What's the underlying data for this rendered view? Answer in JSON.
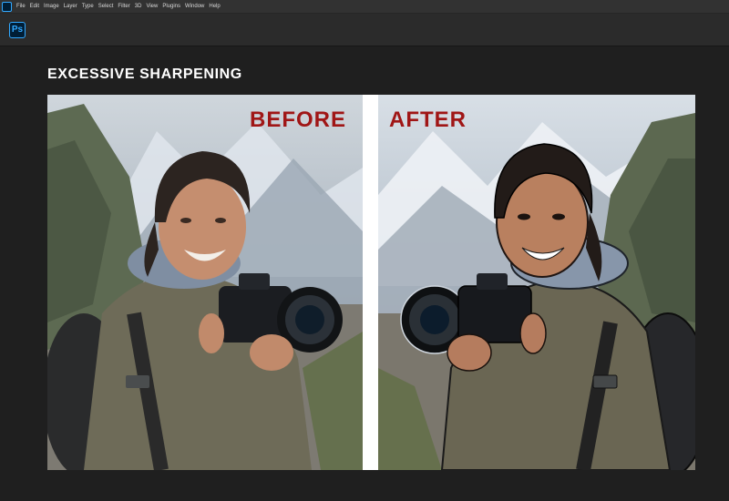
{
  "menubar": {
    "items": [
      "File",
      "Edit",
      "Image",
      "Layer",
      "Type",
      "Select",
      "Filter",
      "3D",
      "View",
      "Plugins",
      "Window",
      "Help"
    ]
  },
  "app": {
    "logo_text": "Ps"
  },
  "document": {
    "title": "EXCESSIVE SHARPENING",
    "before_label": "BEFORE",
    "after_label": "AFTER"
  }
}
